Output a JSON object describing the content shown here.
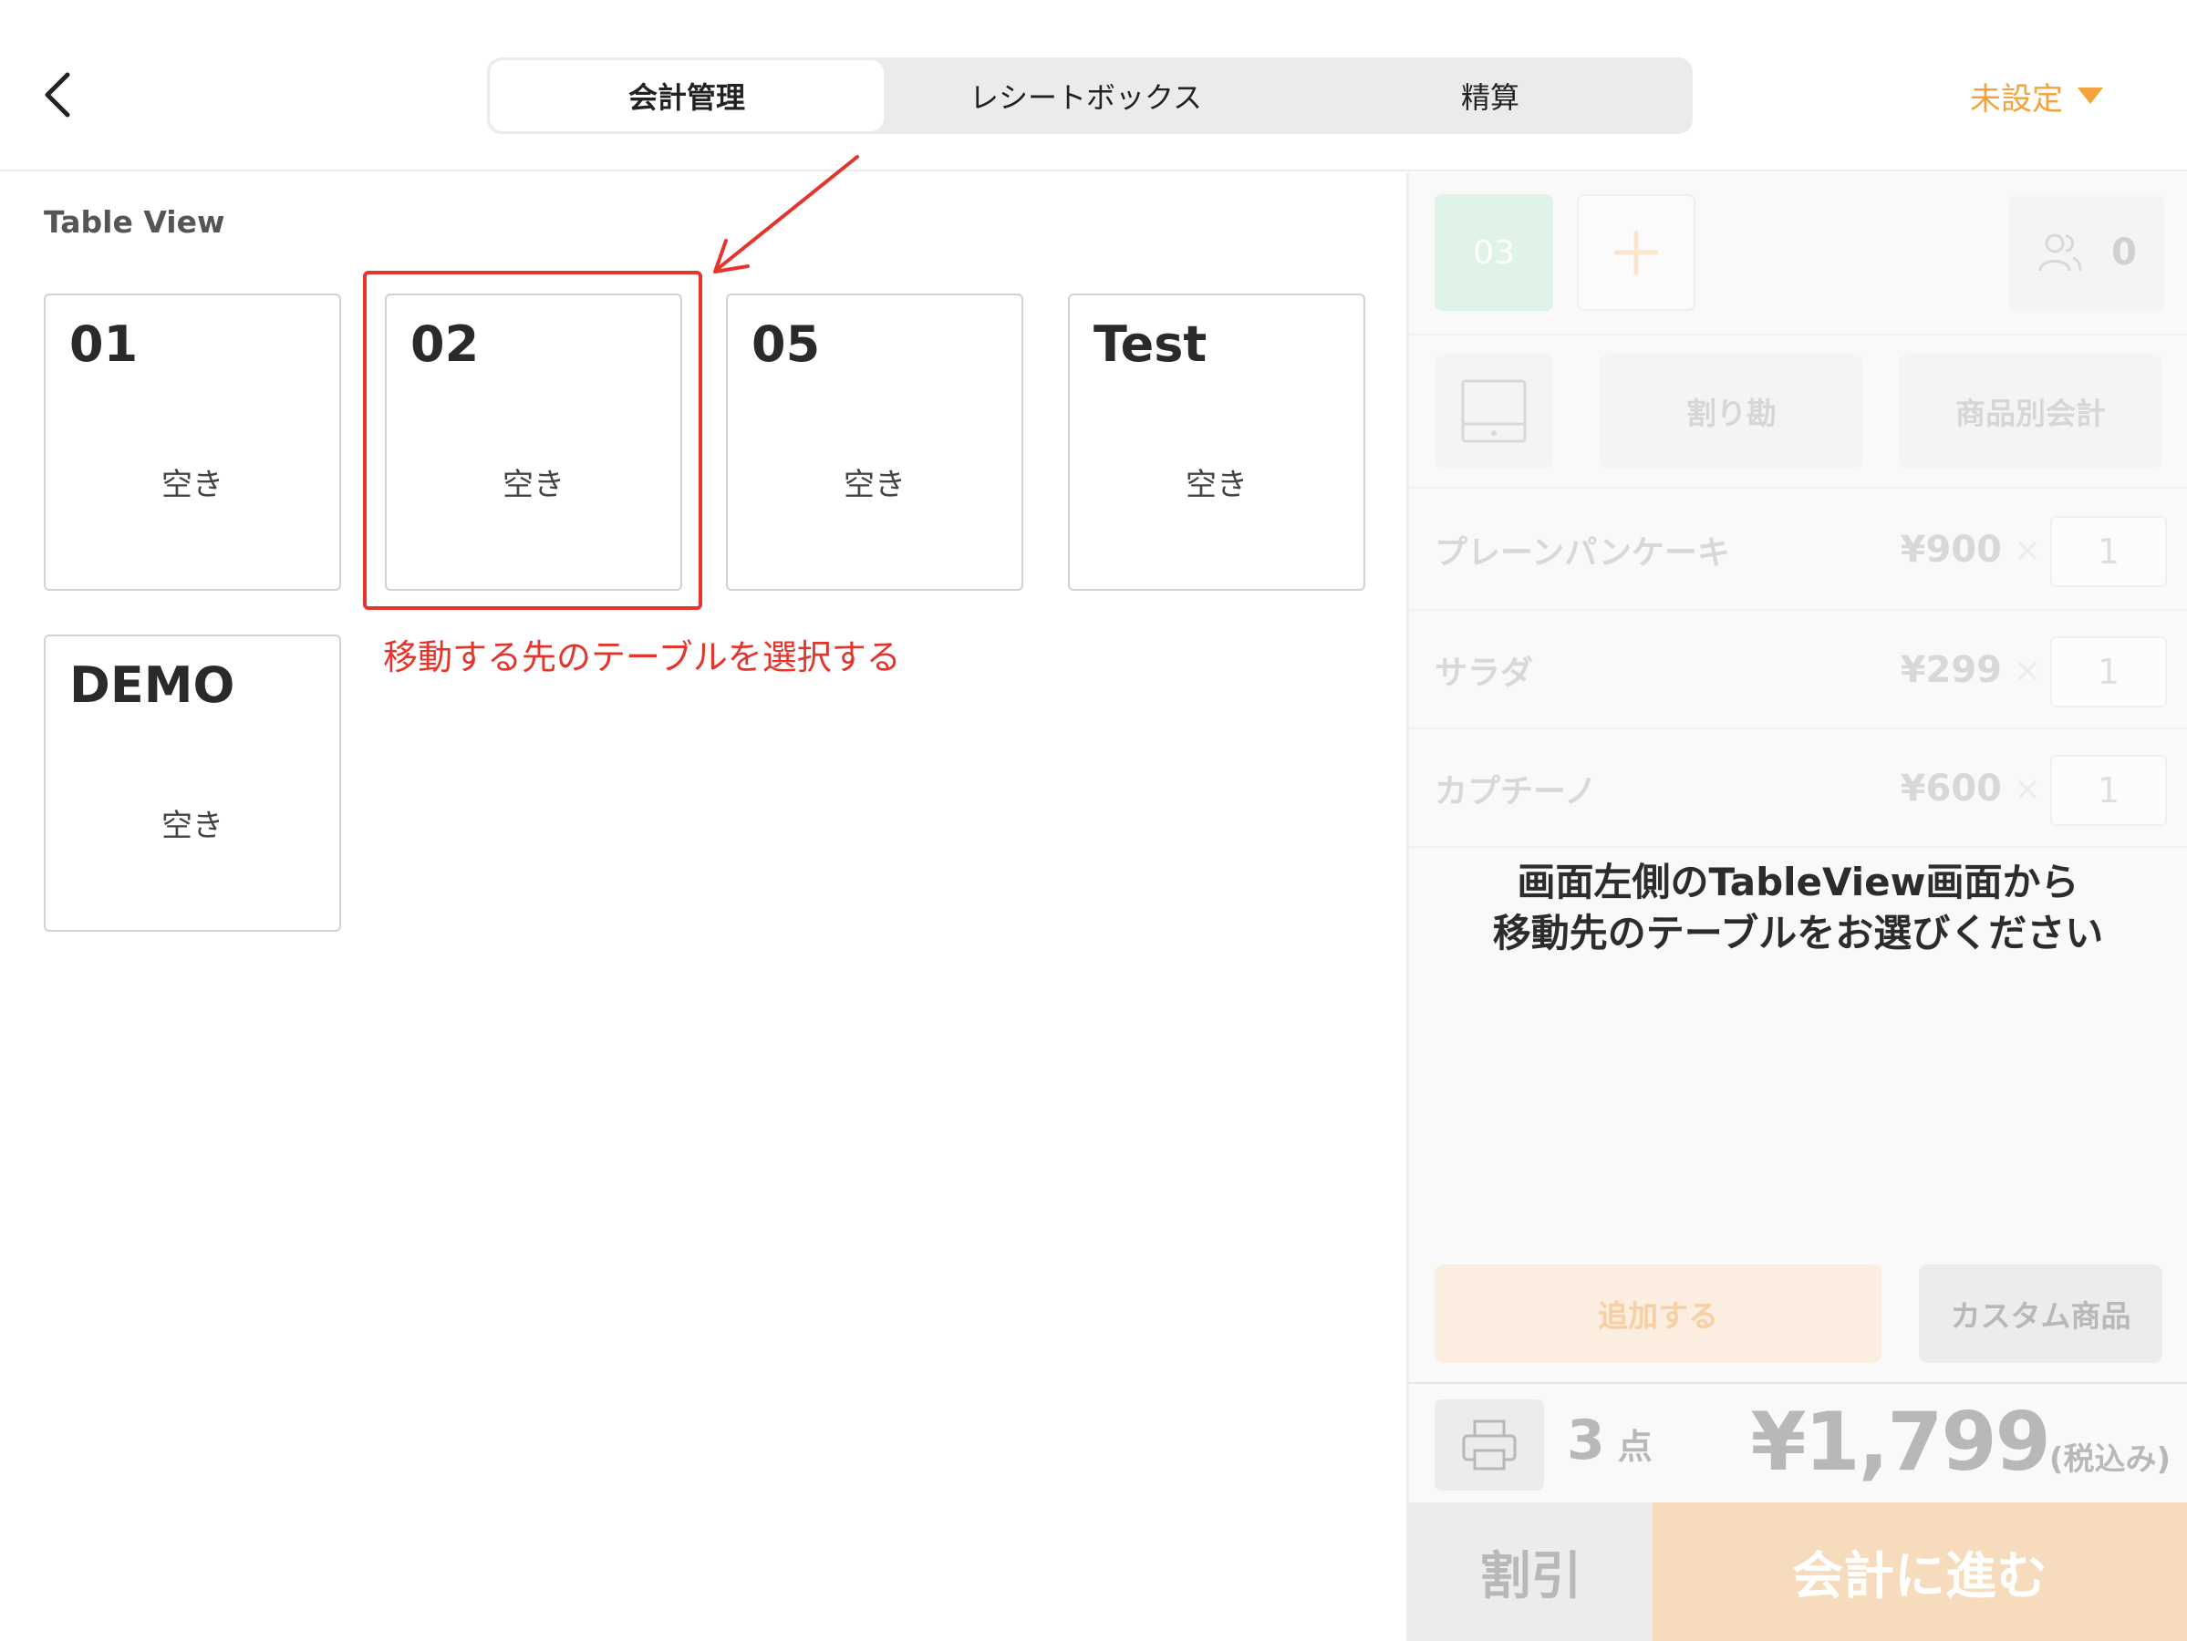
{
  "header": {
    "back_icon": "chevron-left-icon",
    "tabs": [
      {
        "label": "会計管理",
        "selected": true
      },
      {
        "label": "レシートボックス",
        "selected": false
      },
      {
        "label": "精算",
        "selected": false
      }
    ],
    "status_dropdown": {
      "label": "未設定",
      "icon": "caret-down-icon"
    }
  },
  "table_view": {
    "title": "Table View",
    "tables": [
      {
        "number": "01",
        "status": "空き"
      },
      {
        "number": "02",
        "status": "空き"
      },
      {
        "number": "05",
        "status": "空き"
      },
      {
        "number": "Test",
        "status": "空き"
      },
      {
        "number": "DEMO",
        "status": "空き"
      }
    ]
  },
  "annotation": {
    "text": "移動する先のテーブルを選択する",
    "color": "#e4352c"
  },
  "order_panel": {
    "current_table": "03",
    "add_table_icon": "plus-icon",
    "guests": {
      "icon": "people-icon",
      "count": "0"
    },
    "register_icon": "cash-drawer-icon",
    "split_label": "割り勘",
    "item_pay_label": "商品別会計",
    "items": [
      {
        "name": "プレーンパンケーキ",
        "price": "¥900",
        "times": "×",
        "qty": "1"
      },
      {
        "name": "サラダ",
        "price": "¥299",
        "times": "×",
        "qty": "1"
      },
      {
        "name": "カプチーノ",
        "price": "¥600",
        "times": "×",
        "qty": "1"
      }
    ],
    "message_line1": "画面左側のTableView画面から",
    "message_line2": "移動先のテーブルをお選びください",
    "add_label": "追加する",
    "custom_label": "カスタム商品",
    "print_icon": "printer-icon",
    "count": "3",
    "count_unit": "点",
    "total": "¥1,799",
    "tax_note": "(税込み)",
    "discount_label": "割引",
    "checkout_label": "会計に進む"
  },
  "colors": {
    "accent": "#f3a33a",
    "table_chip": "#c6e9d5",
    "checkout_bg": "#f6dcbc"
  }
}
